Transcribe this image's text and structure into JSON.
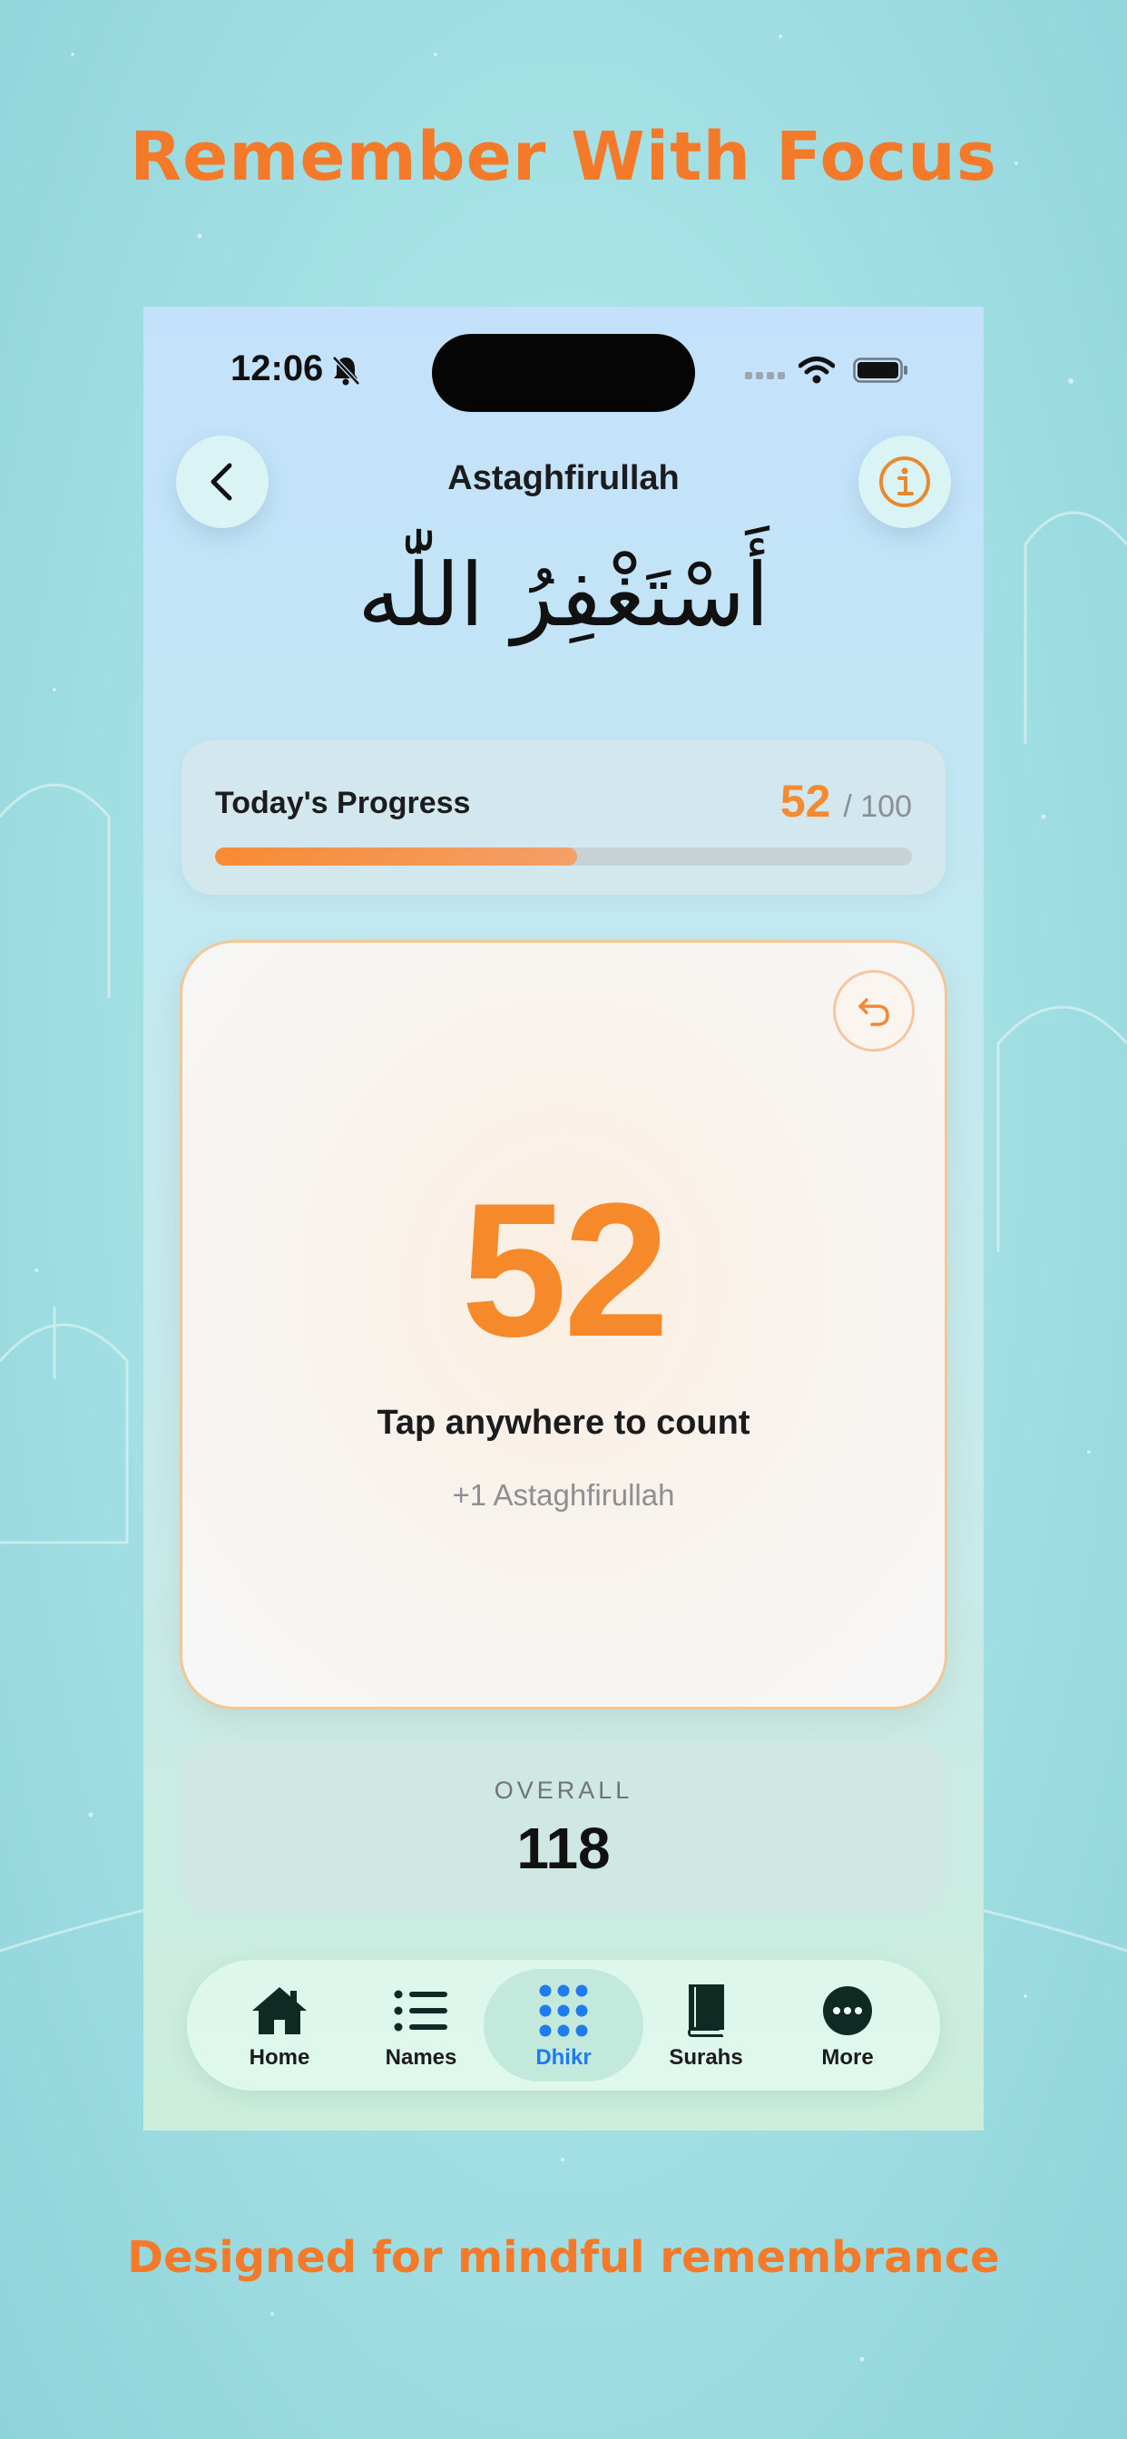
{
  "promo": {
    "headline": "Remember With Focus",
    "tagline": "Designed for mindful remembrance"
  },
  "status_bar": {
    "time": "12:06"
  },
  "header": {
    "title": "Astaghfirullah",
    "arabic_text": "أَسْتَغْفِرُ اللّٰه"
  },
  "progress": {
    "label": "Today's Progress",
    "count": "52",
    "total": "/ 100",
    "fraction": 0.52
  },
  "counter": {
    "value": "52",
    "hint": "Tap anywhere to count",
    "increment_label": "+1 Astaghfirullah"
  },
  "overall": {
    "label": "OVERALL",
    "value": "118"
  },
  "tabs": [
    {
      "label": "Home",
      "icon": "home-icon",
      "active": false
    },
    {
      "label": "Names",
      "icon": "list-icon",
      "active": false
    },
    {
      "label": "Dhikr",
      "icon": "grid-dots-icon",
      "active": true
    },
    {
      "label": "Surahs",
      "icon": "book-icon",
      "active": false
    },
    {
      "label": "More",
      "icon": "more-icon",
      "active": false
    }
  ],
  "colors": {
    "accent": "#f6892a",
    "active_tab": "#1e7bf0",
    "background": "#a6e2e6"
  }
}
